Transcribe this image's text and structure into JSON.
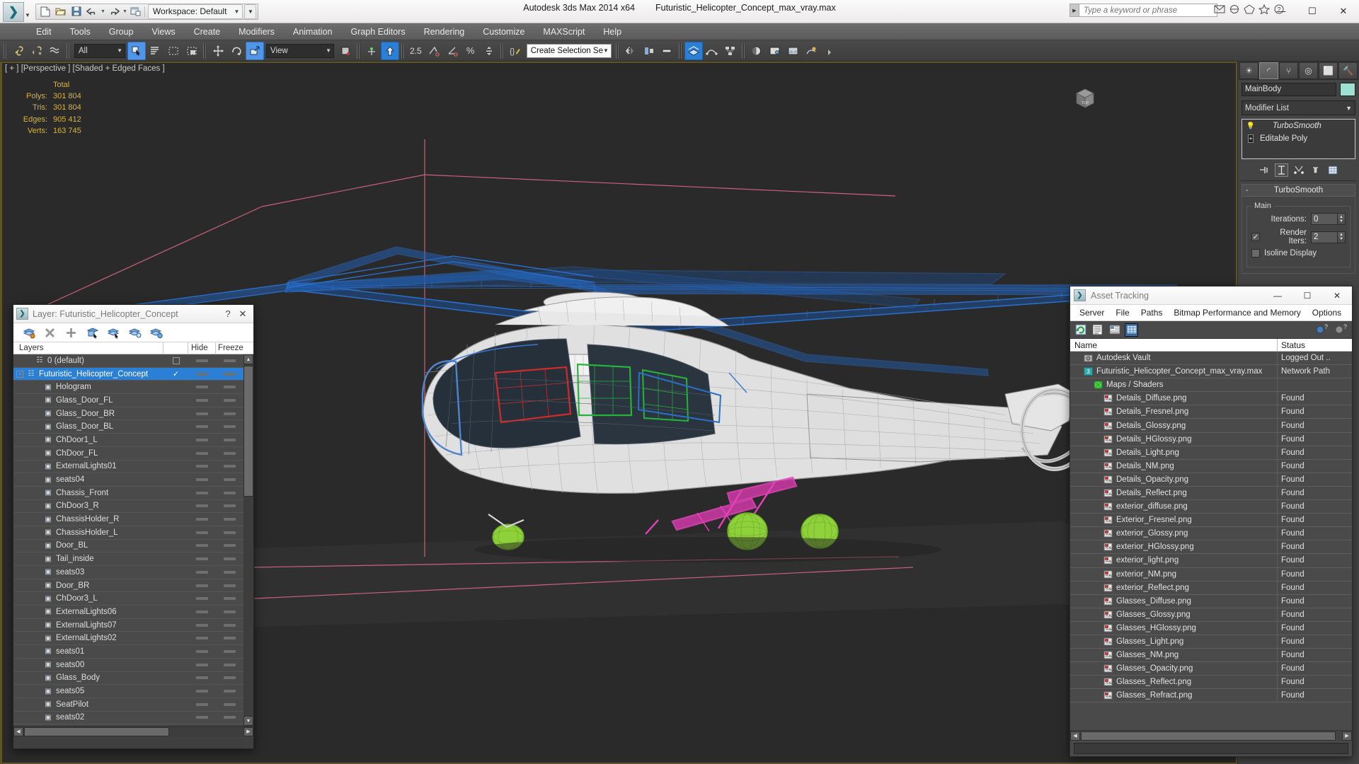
{
  "app": {
    "title": "Autodesk 3ds Max  2014 x64",
    "filename": "Futuristic_Helicopter_Concept_max_vray.max",
    "logo_glyph": "❯"
  },
  "quick_access": {
    "workspace_label": "Workspace: Default",
    "buttons": [
      {
        "name": "new-file",
        "glyph": "🗋"
      },
      {
        "name": "open-file",
        "glyph": "📂"
      },
      {
        "name": "save-file",
        "glyph": "💾"
      },
      {
        "name": "undo",
        "glyph": "↶"
      },
      {
        "name": "redo",
        "glyph": "↷"
      },
      {
        "name": "project-folder",
        "glyph": "🗂"
      }
    ]
  },
  "search": {
    "placeholder": "Type a keyword or phrase",
    "value": ""
  },
  "window_buttons": {
    "minimize": "—",
    "maximize": "☐",
    "close": "✕"
  },
  "menubar": {
    "items": [
      "Edit",
      "Tools",
      "Group",
      "Views",
      "Create",
      "Modifiers",
      "Animation",
      "Graph Editors",
      "Rendering",
      "Customize",
      "MAXScript",
      "Help"
    ]
  },
  "toolbar": {
    "selection_filter": "All",
    "reference_coord": "View",
    "named_selection_set": "Create Selection Se",
    "angle_snap_value": "2.5",
    "percent_glyph": "%",
    "buttons": [
      {
        "name": "select-link",
        "glyph": "🔗"
      },
      {
        "name": "unlink-selection",
        "glyph": "✂"
      },
      {
        "name": "bind-space-warp",
        "glyph": "≋"
      },
      {
        "name": "select-object",
        "glyph": "↖"
      },
      {
        "name": "select-by-name",
        "glyph": "☰"
      },
      {
        "name": "rectangular-select-region",
        "glyph": "⬚"
      },
      {
        "name": "window-crossing",
        "glyph": "◰"
      },
      {
        "name": "select-and-move",
        "glyph": "✥"
      },
      {
        "name": "select-and-rotate",
        "glyph": "↻"
      },
      {
        "name": "select-and-scale",
        "glyph": "⤡"
      },
      {
        "name": "use-center-flyout",
        "glyph": "▣"
      },
      {
        "name": "select-and-manipulate",
        "glyph": "⬆"
      },
      {
        "name": "snaps-toggle",
        "glyph": "◢"
      },
      {
        "name": "angle-snap-toggle",
        "glyph": "∠"
      },
      {
        "name": "percent-snap-toggle",
        "glyph": "%"
      },
      {
        "name": "spinner-snap-toggle",
        "glyph": "⬍"
      },
      {
        "name": "edit-named-selection-sets",
        "glyph": "✎"
      },
      {
        "name": "mirror",
        "glyph": "▷"
      },
      {
        "name": "align",
        "glyph": "◧"
      },
      {
        "name": "layer-manager",
        "glyph": "≡"
      },
      {
        "name": "graphite-modeling-tools",
        "glyph": "☲"
      },
      {
        "name": "curve-editor",
        "glyph": "〰"
      },
      {
        "name": "schematic-view",
        "glyph": "▦"
      },
      {
        "name": "material-editor",
        "glyph": "◐"
      },
      {
        "name": "render-setup",
        "glyph": "⚙"
      },
      {
        "name": "rendered-frame-window",
        "glyph": "🖼"
      },
      {
        "name": "render-production",
        "glyph": "☕"
      }
    ]
  },
  "viewport": {
    "label": "[ + ] [Perspective ] [Shaded + Edged Faces ]",
    "stats_header": "Total",
    "stats": [
      {
        "key": "Polys:",
        "value": "301 804"
      },
      {
        "key": "Tris:",
        "value": "301 804"
      },
      {
        "key": "Edges:",
        "value": "905 412"
      },
      {
        "key": "Verts:",
        "value": "163 745"
      }
    ],
    "stats_color": "#d7b43a",
    "background": "#2a2a2a"
  },
  "command_panel": {
    "tabs": [
      {
        "name": "create-tab",
        "glyph": "☀"
      },
      {
        "name": "modify-tab",
        "glyph": "◜"
      },
      {
        "name": "hierarchy-tab",
        "glyph": "⑂"
      },
      {
        "name": "motion-tab",
        "glyph": "◎"
      },
      {
        "name": "display-tab",
        "glyph": "⬜"
      },
      {
        "name": "utilities-tab",
        "glyph": "🔨"
      }
    ],
    "selected_tab_index": 1,
    "object_name": "MainBody",
    "object_color": "#9fe0d2",
    "modifier_list_label": "Modifier List",
    "stack": [
      {
        "label": "TurboSmooth",
        "icon": "lightbulb-icon",
        "italic": true
      },
      {
        "label": "Editable Poly",
        "icon": "plus-icon",
        "italic": false
      }
    ],
    "stack_tools": [
      {
        "name": "pin-stack",
        "glyph": "⇥"
      },
      {
        "name": "show-end-result",
        "glyph": "⎉"
      },
      {
        "name": "make-unique",
        "glyph": "⑂"
      },
      {
        "name": "remove-modifier",
        "glyph": "♻"
      },
      {
        "name": "configure-modifier-sets",
        "glyph": "▦"
      }
    ],
    "rollout": {
      "title": "TurboSmooth",
      "collapse_glyph": "-",
      "group_label": "Main",
      "iterations_label": "Iterations:",
      "iterations_value": "0",
      "render_iters_label": "Render Iters:",
      "render_iters_value": "2",
      "render_iters_checked": true,
      "isoline_label": "Isoline Display",
      "isoline_checked": false
    }
  },
  "layer_dialog": {
    "title": "Layer: Futuristic_Helicopter_Concept",
    "help_glyph": "?",
    "close_glyph": "✕",
    "tools": [
      {
        "name": "create-new-layer-icon",
        "glyph": "≡"
      },
      {
        "name": "delete-layer-icon",
        "glyph": "✕"
      },
      {
        "name": "add-selection-to-layer-icon",
        "glyph": "＋"
      },
      {
        "name": "select-objects-in-layer-icon",
        "glyph": "◰"
      },
      {
        "name": "select-highlighted-layers-icon",
        "glyph": "≡"
      },
      {
        "name": "highlight-selected-objects-layers-icon",
        "glyph": "⊙"
      },
      {
        "name": "layer-properties-icon",
        "glyph": "⚙"
      }
    ],
    "columns": [
      "Layers",
      "",
      "Hide",
      "Freeze",
      ""
    ],
    "rows": [
      {
        "name": "0 (default)",
        "indent": 1,
        "type": "layer",
        "expander": null,
        "check": "box",
        "selected": false
      },
      {
        "name": "Futuristic_Helicopter_Concept",
        "indent": 0,
        "type": "layer",
        "expander": "-",
        "check": "tick",
        "selected": true
      },
      {
        "name": "Hologram",
        "indent": 2,
        "type": "object",
        "expander": null,
        "check": "",
        "selected": false
      },
      {
        "name": "Glass_Door_FL",
        "indent": 2,
        "type": "object",
        "expander": null,
        "check": "",
        "selected": false
      },
      {
        "name": "Glass_Door_BR",
        "indent": 2,
        "type": "object",
        "expander": null,
        "check": "",
        "selected": false
      },
      {
        "name": "Glass_Door_BL",
        "indent": 2,
        "type": "object",
        "expander": null,
        "check": "",
        "selected": false
      },
      {
        "name": "ChDoor1_L",
        "indent": 2,
        "type": "object",
        "expander": null,
        "check": "",
        "selected": false
      },
      {
        "name": "ChDoor_FL",
        "indent": 2,
        "type": "object",
        "expander": null,
        "check": "",
        "selected": false
      },
      {
        "name": "ExternalLights01",
        "indent": 2,
        "type": "object",
        "expander": null,
        "check": "",
        "selected": false
      },
      {
        "name": "seats04",
        "indent": 2,
        "type": "object",
        "expander": null,
        "check": "",
        "selected": false
      },
      {
        "name": "Chassis_Front",
        "indent": 2,
        "type": "object",
        "expander": null,
        "check": "",
        "selected": false
      },
      {
        "name": "ChDoor3_R",
        "indent": 2,
        "type": "object",
        "expander": null,
        "check": "",
        "selected": false
      },
      {
        "name": "ChassisHolder_R",
        "indent": 2,
        "type": "object",
        "expander": null,
        "check": "",
        "selected": false
      },
      {
        "name": "ChassisHolder_L",
        "indent": 2,
        "type": "object",
        "expander": null,
        "check": "",
        "selected": false
      },
      {
        "name": "Door_BL",
        "indent": 2,
        "type": "object",
        "expander": null,
        "check": "",
        "selected": false
      },
      {
        "name": "Tail_inside",
        "indent": 2,
        "type": "object",
        "expander": null,
        "check": "",
        "selected": false
      },
      {
        "name": "seats03",
        "indent": 2,
        "type": "object",
        "expander": null,
        "check": "",
        "selected": false
      },
      {
        "name": "Door_BR",
        "indent": 2,
        "type": "object",
        "expander": null,
        "check": "",
        "selected": false
      },
      {
        "name": "ChDoor3_L",
        "indent": 2,
        "type": "object",
        "expander": null,
        "check": "",
        "selected": false
      },
      {
        "name": "ExternalLights06",
        "indent": 2,
        "type": "object",
        "expander": null,
        "check": "",
        "selected": false
      },
      {
        "name": "ExternalLights07",
        "indent": 2,
        "type": "object",
        "expander": null,
        "check": "",
        "selected": false
      },
      {
        "name": "ExternalLights02",
        "indent": 2,
        "type": "object",
        "expander": null,
        "check": "",
        "selected": false
      },
      {
        "name": "seats01",
        "indent": 2,
        "type": "object",
        "expander": null,
        "check": "",
        "selected": false
      },
      {
        "name": "seats00",
        "indent": 2,
        "type": "object",
        "expander": null,
        "check": "",
        "selected": false
      },
      {
        "name": "Glass_Body",
        "indent": 2,
        "type": "object",
        "expander": null,
        "check": "",
        "selected": false
      },
      {
        "name": "seats05",
        "indent": 2,
        "type": "object",
        "expander": null,
        "check": "",
        "selected": false
      },
      {
        "name": "SeatPilot",
        "indent": 2,
        "type": "object",
        "expander": null,
        "check": "",
        "selected": false
      },
      {
        "name": "seats02",
        "indent": 2,
        "type": "object",
        "expander": null,
        "check": "",
        "selected": false
      }
    ]
  },
  "asset_tracking": {
    "title": "Asset Tracking",
    "window_buttons": {
      "minimize": "—",
      "maximize": "☐",
      "close": "✕"
    },
    "menu": [
      "Server",
      "File",
      "Paths",
      "Bitmap Performance and Memory",
      "Options"
    ],
    "tools": [
      {
        "name": "refresh-icon",
        "glyph": "↻"
      },
      {
        "name": "list-view-icon",
        "glyph": "≡"
      },
      {
        "name": "detail-view-icon",
        "glyph": "▤"
      },
      {
        "name": "grid-view-icon",
        "glyph": "▦"
      }
    ],
    "help_icons": [
      {
        "name": "help-vault-icon",
        "glyph": "?"
      },
      {
        "name": "help-icon",
        "glyph": "?"
      }
    ],
    "columns": [
      "Name",
      "Status"
    ],
    "rows": [
      {
        "name": "Autodesk Vault",
        "status": "Logged Out ..",
        "indent": 1,
        "icon": "vault-icon"
      },
      {
        "name": "Futuristic_Helicopter_Concept_max_vray.max",
        "status": "Network Path",
        "indent": 1,
        "icon": "max-file-icon"
      },
      {
        "name": "Maps / Shaders",
        "status": "",
        "indent": 2,
        "icon": "maps-icon"
      },
      {
        "name": "Details_Diffuse.png",
        "status": "Found",
        "indent": 3,
        "icon": "bitmap-icon"
      },
      {
        "name": "Details_Fresnel.png",
        "status": "Found",
        "indent": 3,
        "icon": "bitmap-icon"
      },
      {
        "name": "Details_Glossy.png",
        "status": "Found",
        "indent": 3,
        "icon": "bitmap-icon"
      },
      {
        "name": "Details_HGlossy.png",
        "status": "Found",
        "indent": 3,
        "icon": "bitmap-icon"
      },
      {
        "name": "Details_Light.png",
        "status": "Found",
        "indent": 3,
        "icon": "bitmap-icon"
      },
      {
        "name": "Details_NM.png",
        "status": "Found",
        "indent": 3,
        "icon": "bitmap-icon"
      },
      {
        "name": "Details_Opacity.png",
        "status": "Found",
        "indent": 3,
        "icon": "bitmap-icon"
      },
      {
        "name": "Details_Reflect.png",
        "status": "Found",
        "indent": 3,
        "icon": "bitmap-icon"
      },
      {
        "name": "exterior_diffuse.png",
        "status": "Found",
        "indent": 3,
        "icon": "bitmap-icon"
      },
      {
        "name": "Exterior_Fresnel.png",
        "status": "Found",
        "indent": 3,
        "icon": "bitmap-icon"
      },
      {
        "name": "exterior_Glossy.png",
        "status": "Found",
        "indent": 3,
        "icon": "bitmap-icon"
      },
      {
        "name": "exterior_HGlossy.png",
        "status": "Found",
        "indent": 3,
        "icon": "bitmap-icon"
      },
      {
        "name": "exterior_light.png",
        "status": "Found",
        "indent": 3,
        "icon": "bitmap-icon"
      },
      {
        "name": "exterior_NM.png",
        "status": "Found",
        "indent": 3,
        "icon": "bitmap-icon"
      },
      {
        "name": "exterior_Reflect.png",
        "status": "Found",
        "indent": 3,
        "icon": "bitmap-icon"
      },
      {
        "name": "Glasses_Diffuse.png",
        "status": "Found",
        "indent": 3,
        "icon": "bitmap-icon"
      },
      {
        "name": "Glasses_Glossy.png",
        "status": "Found",
        "indent": 3,
        "icon": "bitmap-icon"
      },
      {
        "name": "Glasses_HGlossy.png",
        "status": "Found",
        "indent": 3,
        "icon": "bitmap-icon"
      },
      {
        "name": "Glasses_Light.png",
        "status": "Found",
        "indent": 3,
        "icon": "bitmap-icon"
      },
      {
        "name": "Glasses_NM.png",
        "status": "Found",
        "indent": 3,
        "icon": "bitmap-icon"
      },
      {
        "name": "Glasses_Opacity.png",
        "status": "Found",
        "indent": 3,
        "icon": "bitmap-icon"
      },
      {
        "name": "Glasses_Reflect.png",
        "status": "Found",
        "indent": 3,
        "icon": "bitmap-icon"
      },
      {
        "name": "Glasses_Refract.png",
        "status": "Found",
        "indent": 3,
        "icon": "bitmap-icon"
      }
    ]
  },
  "scene_colors": {
    "rotor_blue": "#2a6ec8",
    "body_white": "#e8e8e8",
    "grid_pink": "#d4647f",
    "skid_magenta": "#e442b8",
    "wheel_green": "#8ed13a",
    "glass_dark": "#26303a",
    "panel_red": "#d02b2b",
    "panel_green": "#25b33c"
  }
}
